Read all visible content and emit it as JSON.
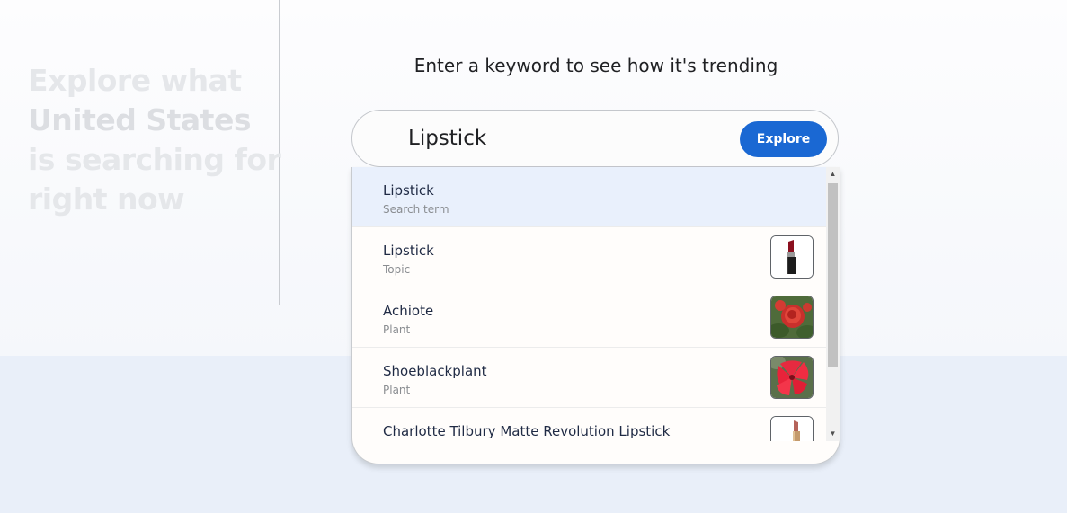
{
  "hero": {
    "line1": "Explore what",
    "line2": "United States",
    "line3": "is searching for",
    "line4": "right now"
  },
  "prompt": "Enter a keyword to see how it's trending",
  "search": {
    "value": "Lipstick",
    "button_label": "Explore"
  },
  "suggestions": [
    {
      "title": "Lipstick",
      "subtitle": "Search term",
      "thumbnail": null
    },
    {
      "title": "Lipstick",
      "subtitle": "Topic",
      "thumbnail": "lipstick-image"
    },
    {
      "title": "Achiote",
      "subtitle": "Plant",
      "thumbnail": "red-rose-image"
    },
    {
      "title": "Shoeblackplant",
      "subtitle": "Plant",
      "thumbnail": "red-hibiscus-image"
    },
    {
      "title": "Charlotte Tilbury Matte Revolution Lipstick",
      "subtitle": "",
      "thumbnail": "lipstick-tube-image"
    }
  ],
  "colors": {
    "accent": "#1a68d3",
    "highlight_row": "#e9f0fc",
    "bottom_band": "#e9eff9"
  }
}
